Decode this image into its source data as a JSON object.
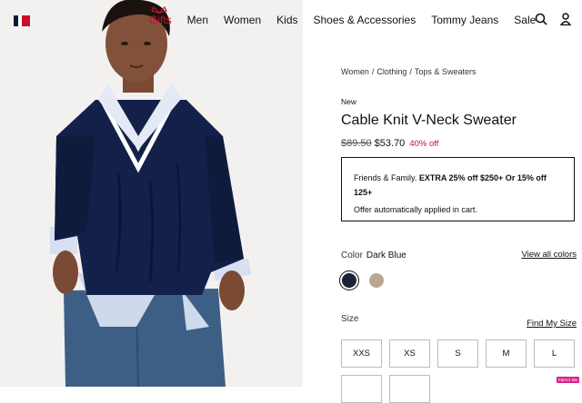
{
  "nav": {
    "items": [
      "Gifts",
      "Men",
      "Women",
      "Kids",
      "Shoes & Accessories",
      "Tommy Jeans",
      "Sale"
    ]
  },
  "breadcrumb": [
    "Women",
    "Clothing",
    "Tops & Sweaters"
  ],
  "product": {
    "badge": "New",
    "title": "Cable Knit V-Neck Sweater",
    "old_price": "$89.50",
    "price": "$53.70",
    "discount": "40% off"
  },
  "promo": {
    "prefix": "Friends & Family. ",
    "bold": "EXTRA 25% off $250+ Or 15% off 125+",
    "sub": "Offer automatically applied in cart."
  },
  "color": {
    "label": "Color",
    "selected": "Dark Blue",
    "view_all": "View all colors",
    "swatches": [
      "#1c2238",
      "#b9a88f"
    ]
  },
  "size": {
    "label": "Size",
    "find": "Find My Size",
    "options": [
      "XXS",
      "XS",
      "S",
      "M",
      "L"
    ]
  },
  "colors": {
    "accent": "#c8102e",
    "navy": "#0b1a3a"
  },
  "icons": [
    "flag-logo-icon",
    "gift-bow-icon",
    "search-icon",
    "user-icon"
  ],
  "corner_badge": "Paint it Me"
}
